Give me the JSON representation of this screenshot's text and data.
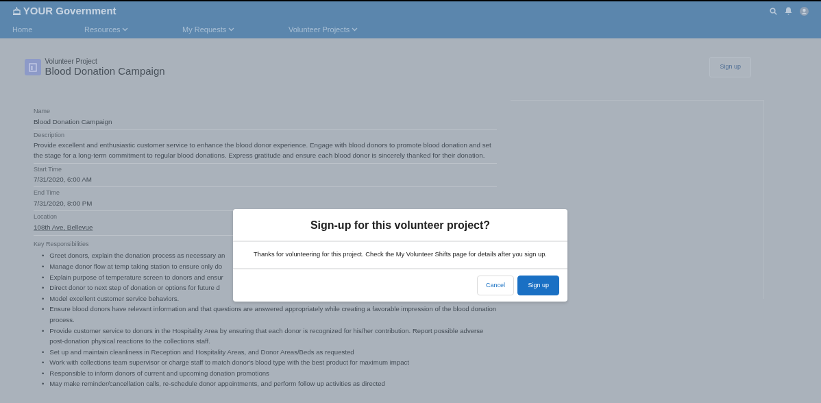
{
  "app": {
    "title": "YOUR Government"
  },
  "nav": [
    {
      "label": "Home",
      "has_menu": false
    },
    {
      "label": "Resources",
      "has_menu": true
    },
    {
      "label": "My Requests",
      "has_menu": true
    },
    {
      "label": "Volunteer Projects",
      "has_menu": true
    }
  ],
  "record": {
    "type_label": "Volunteer Project",
    "title": "Blood Donation Campaign",
    "action": "Sign up"
  },
  "fields": [
    {
      "label": "Name",
      "value": "Blood Donation Campaign",
      "kind": "text"
    },
    {
      "label": "Description",
      "value": "Provide excellent and enthusiastic customer service to enhance the blood donor experience. Engage with blood donors to promote blood donation and set the stage for a long-term commitment to regular blood donations. Express gratitude and ensure each blood donor is sincerely thanked for their donation.",
      "kind": "text"
    },
    {
      "label": "Start Time",
      "value": "7/31/2020, 6:00 AM",
      "kind": "text"
    },
    {
      "label": "End Time",
      "value": "7/31/2020, 8:00 PM",
      "kind": "text"
    },
    {
      "label": "Location",
      "value": "108th Ave, Bellevue",
      "kind": "link"
    }
  ],
  "responsibilities": {
    "label": "Key Responsibilities",
    "marker": "•",
    "items": [
      "Greet donors, explain the donation process as necessary an",
      "Manage donor flow at temp taking station to ensure only do",
      "Explain purpose of temperature screen to donors and ensur",
      "Direct donor to next step of donation or options for future d",
      "Model excellent customer service behaviors.",
      "Ensure blood donors have relevant information and that questions are answered appropriately while creating a favorable impression of the blood donation process.",
      "Provide customer service to donors in the Hospitality Area by ensuring that each donor is recognized for his/her contribution. Report possible adverse post-donation physical reactions to the collections staff.",
      "Set up and maintain cleanliness in Reception and Hospitality Areas, and Donor Areas/Beds as requested",
      "Work with collections team supervisor or charge staff to match donor's blood type with the best product for maximum impact",
      "Responsible to inform donors of current and upcoming donation promotions",
      "May make reminder/cancellation calls, re-schedule donor appointments, and perform follow up activities as directed"
    ]
  },
  "modal": {
    "title": "Sign-up for this volunteer project?",
    "message": "Thanks for volunteering for this project. Check the My Volunteer Shifts page for details after you sign up.",
    "buttons": [
      {
        "label": "Cancel",
        "kind": "neutral"
      },
      {
        "label": "Sign up",
        "kind": "brand"
      }
    ]
  }
}
